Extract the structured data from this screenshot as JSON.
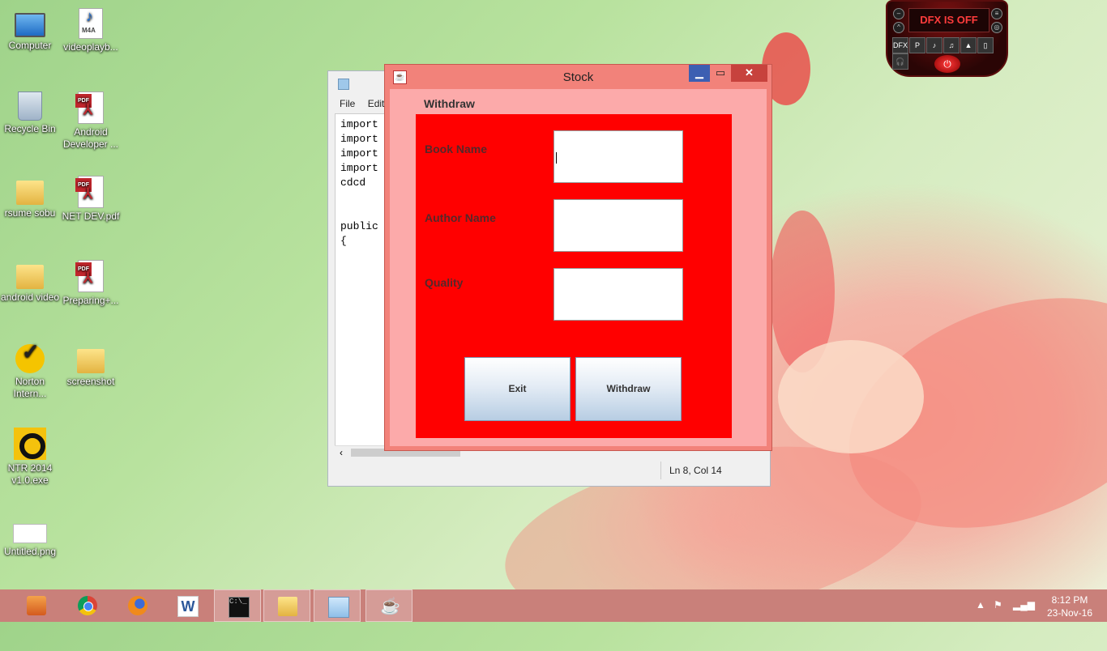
{
  "desktop": {
    "icons": [
      {
        "label": "Computer",
        "icon": "computer-icon"
      },
      {
        "label": "videoplayb...",
        "icon": "audio-file-icon",
        "badge": "M4A"
      },
      {
        "label": "Recycle Bin",
        "icon": "recycle-bin-icon"
      },
      {
        "label": "Android Developer ...",
        "icon": "pdf-icon",
        "badge": "PDF"
      },
      {
        "label": "rsume sobu",
        "icon": "folder-icon"
      },
      {
        "label": "NET DEV.pdf",
        "icon": "pdf-icon",
        "badge": "PDF"
      },
      {
        "label": "android video",
        "icon": "folder-icon"
      },
      {
        "label": "Preparing+...",
        "icon": "pdf-icon",
        "badge": "PDF"
      },
      {
        "label": "Norton Intern...",
        "icon": "norton-icon"
      },
      {
        "label": "screenshot",
        "icon": "folder-icon"
      },
      {
        "label": "NTR 2014 v1.0.exe",
        "icon": "ntr-icon"
      },
      {
        "label": "Untitled.png",
        "icon": "image-file-icon"
      }
    ]
  },
  "notepad": {
    "menu": [
      "File",
      "Edit"
    ],
    "lines": [
      "import",
      "import",
      "import",
      "import",
      "cdcd",
      "",
      "",
      "public",
      "{"
    ],
    "status_position": "Ln 8, Col 14"
  },
  "stock_window": {
    "title": "Stock",
    "group_label": "Withdraw",
    "fields": [
      {
        "label": "Book Name",
        "value": ""
      },
      {
        "label": "Author Name",
        "value": ""
      },
      {
        "label": "Quality",
        "value": ""
      }
    ],
    "exit_label": "Exit",
    "withdraw_label": "Withdraw",
    "colors": {
      "titlebar": "#f2827a",
      "content": "#fcaaaa",
      "panel": "#ff0000"
    }
  },
  "dfx": {
    "display": "DFX IS OFF",
    "buttons": [
      "DFX",
      "P",
      "♪",
      "♫",
      "▲",
      "▯",
      "🎧"
    ]
  },
  "taskbar": {
    "items": [
      "file-explorer-icon",
      "chrome-icon",
      "firefox-icon",
      "word-icon",
      "cmd-icon",
      "folder-icon",
      "notepad-icon",
      "java-icon"
    ],
    "time": "8:12 PM",
    "date": "23-Nov-16"
  }
}
